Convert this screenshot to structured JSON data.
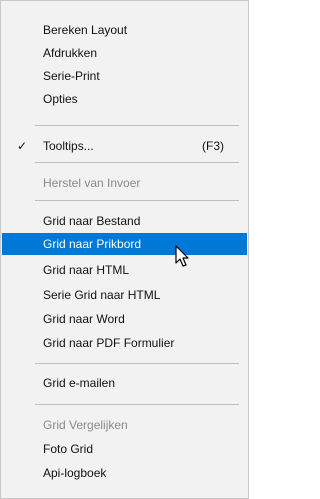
{
  "menu": {
    "items": [
      {
        "label": "Bereken Layout"
      },
      {
        "label": "Afdrukken"
      },
      {
        "label": "Serie-Print"
      },
      {
        "label": "Opties"
      },
      {
        "label": "Tooltips...",
        "checked": true,
        "shortcut": "(F3)"
      },
      {
        "label": "Herstel van Invoer",
        "disabled": true
      },
      {
        "label": "Grid naar Bestand"
      },
      {
        "label": "Grid naar Prikbord",
        "selected": true
      },
      {
        "label": "Grid naar HTML"
      },
      {
        "label": "Serie Grid naar HTML"
      },
      {
        "label": "Grid naar Word"
      },
      {
        "label": "Grid naar PDF Formulier"
      },
      {
        "label": "Grid e-mailen"
      },
      {
        "label": "Grid Vergelijken",
        "disabled": true
      },
      {
        "label": "Foto Grid"
      },
      {
        "label": "Api-logboek"
      }
    ],
    "check_glyph": "✓",
    "selection_color": "#0078d7",
    "cursor_icon": "arrow-pointer-icon"
  }
}
